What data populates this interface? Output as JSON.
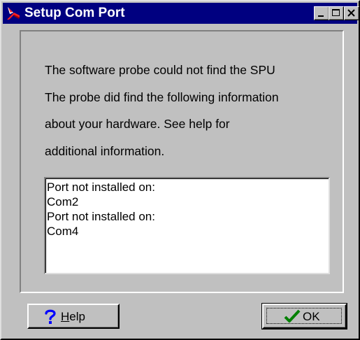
{
  "window": {
    "title": "Setup Com Port",
    "icon": "setup-app-icon"
  },
  "titlebar_buttons": [
    "minimize-icon",
    "maximize-icon",
    "close-icon"
  ],
  "message": {
    "line1": "The software probe could not find the SPU",
    "line2": "The probe did find the following information",
    "line3": "about your hardware.  See help for",
    "line4": "additional information."
  },
  "hardware_list": {
    "items": [
      "Port not installed on:",
      "Com2",
      "Port not installed on:",
      "Com4"
    ]
  },
  "buttons": {
    "help": {
      "mnemonic": "H",
      "rest": "elp",
      "icon": "question-icon"
    },
    "ok": {
      "label": "OK",
      "icon": "checkmark-icon"
    }
  },
  "colors": {
    "titlebar": "#000080",
    "face": "#c0c0c0",
    "help_icon": "#0000ff",
    "ok_check": "#008000"
  }
}
